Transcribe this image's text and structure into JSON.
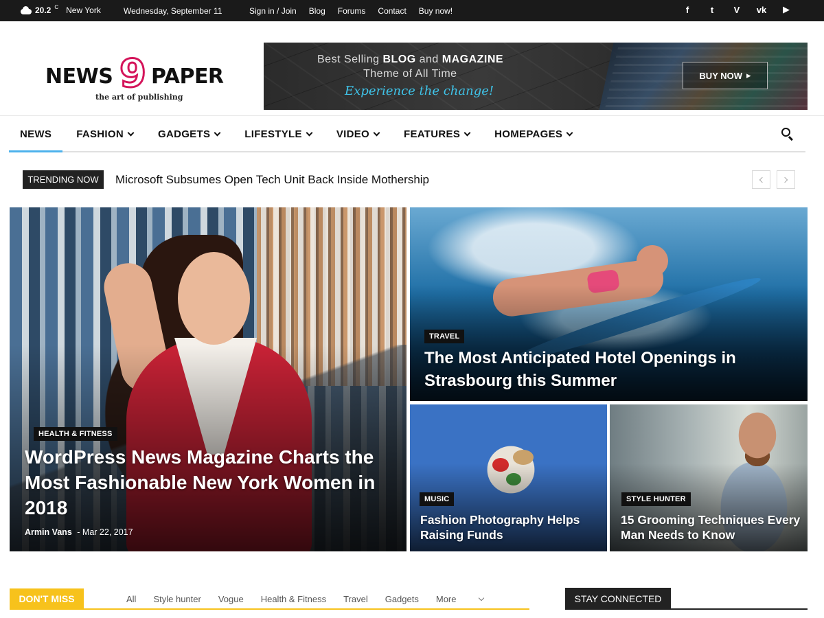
{
  "topbar": {
    "temperature": "20.2",
    "unit": "C",
    "city": "New York",
    "date": "Wednesday, September 11",
    "links": [
      "Sign in / Join",
      "Blog",
      "Forums",
      "Contact",
      "Buy now!"
    ],
    "social_icons": [
      "facebook-icon",
      "twitter-icon",
      "vimeo-icon",
      "vk-icon",
      "youtube-icon"
    ],
    "social_glyphs": [
      "f",
      "t",
      "V",
      "vk",
      "▶"
    ]
  },
  "logo": {
    "word1": "NEWS",
    "digit": "9",
    "word2": "PAPER",
    "tagline": "the art of publishing"
  },
  "banner": {
    "line1_pre": "Best Selling ",
    "line1_bold1": "BLOG",
    "line1_mid": " and ",
    "line1_bold2": "MAGAZINE",
    "line2": "Theme of All Time",
    "line3": "Experience the change!",
    "button": "BUY NOW",
    "button_arrow": "▸"
  },
  "nav": {
    "items": [
      {
        "label": "NEWS",
        "dropdown": false
      },
      {
        "label": "FASHION",
        "dropdown": true
      },
      {
        "label": "GADGETS",
        "dropdown": true
      },
      {
        "label": "LIFESTYLE",
        "dropdown": true
      },
      {
        "label": "VIDEO",
        "dropdown": true
      },
      {
        "label": "FEATURES",
        "dropdown": true
      },
      {
        "label": "HOMEPAGES",
        "dropdown": true
      }
    ]
  },
  "trending": {
    "label": "TRENDING NOW",
    "headline": "Microsoft Subsumes Open Tech Unit Back Inside Mothership"
  },
  "featured": {
    "main": {
      "category": "HEALTH & FITNESS",
      "title": "WordPress News Magazine Charts the Most Fashionable New York Women in 2018",
      "author": "Armin Vans",
      "separator": "-",
      "date": "Mar 22, 2017"
    },
    "travel": {
      "category": "TRAVEL",
      "title": "The Most Anticipated Hotel Openings in Strasbourg this Summer"
    },
    "music": {
      "category": "MUSIC",
      "title": "Fashion Photography Helps Raising Funds"
    },
    "style": {
      "category": "STYLE HUNTER",
      "title": "15 Grooming Techniques Every Man Needs to Know"
    }
  },
  "dont_miss": {
    "label": "DON'T MISS",
    "tabs": [
      "All",
      "Style hunter",
      "Vogue",
      "Health & Fitness",
      "Travel",
      "Gadgets"
    ],
    "more": "More"
  },
  "stay_connected": {
    "label": "STAY CONNECTED"
  },
  "colors": {
    "accent_blue": "#4db2ec",
    "logo_pink": "#d4145a",
    "dont_miss_yellow": "#f7c21c",
    "topbar_bg": "#1a1a1a"
  }
}
